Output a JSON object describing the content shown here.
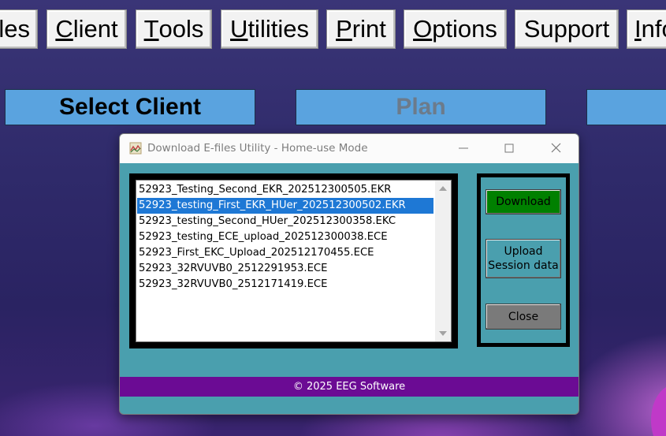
{
  "menu": {
    "items": [
      {
        "pre": "",
        "ul": "",
        "post": "les"
      },
      {
        "pre": "",
        "ul": "C",
        "post": "lient"
      },
      {
        "pre": "",
        "ul": "T",
        "post": "ools"
      },
      {
        "pre": "",
        "ul": "U",
        "post": "tilities"
      },
      {
        "pre": "",
        "ul": "P",
        "post": "rint"
      },
      {
        "pre": "",
        "ul": "O",
        "post": "ptions"
      },
      {
        "pre": "Support",
        "ul": "",
        "post": ""
      },
      {
        "pre": "",
        "ul": "I",
        "post": "nfo"
      }
    ]
  },
  "tabs": {
    "select_client": "Select Client",
    "plan": "Plan",
    "third": ""
  },
  "dialog": {
    "title": "Download E-files Utility - Home-use Mode",
    "files": [
      "52923_Testing_Second_EKR_202512300505.EKR",
      "52923_testing_First_EKR_HUer_202512300502.EKR",
      "52923_testing_Second_HUer_202512300358.EKC",
      "52923_testing_ECE_upload_202512300038.ECE",
      "52923_First_EKC_Upload_202512170455.ECE",
      "52923_32RVUVB0_2512291953.ECE",
      "52923_32RVUVB0_2512171419.ECE"
    ],
    "selected_index": 1,
    "buttons": {
      "download": "Download",
      "upload_line1": "Upload",
      "upload_line2": "Session data",
      "close": "Close"
    },
    "footer": "© 2025 EEG Software"
  },
  "colors": {
    "tab_bg": "#5aa3df",
    "dialog_bg": "#4a9fae",
    "download_bg": "#008000",
    "upload_bg": "#4a9fae",
    "close_bg": "#7a7a7a",
    "footer_bg": "#6b0b94",
    "selection": "#1e78d5"
  },
  "icons": {
    "app": "app-logo-icon",
    "minimize": "minimize-icon",
    "maximize": "maximize-icon",
    "close": "close-icon",
    "scroll_up": "scroll-up-arrow-icon",
    "scroll_down": "scroll-down-arrow-icon"
  }
}
